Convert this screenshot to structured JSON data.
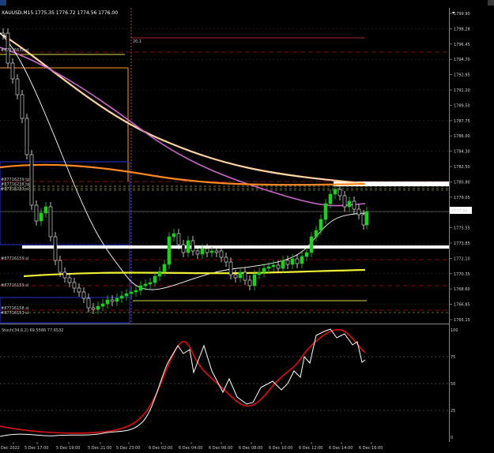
{
  "window": {
    "title": "XAUUSD,M15",
    "ohlc": "1775.35 1776.72 1774.56 1776.00",
    "colors": {
      "background": "#000000",
      "bull": "#22cc22",
      "bear": "#f0f0f0",
      "grid": "#3a3a3a"
    }
  },
  "price_axis": {
    "labels": [
      "1799.90",
      "1798.28",
      "1796.45",
      "1794.70",
      "1792.95",
      "1791.20",
      "1789.50",
      "1787.75",
      "1786.00",
      "1784.30",
      "1782.50",
      "1780.80",
      "1779.05",
      "1777.30",
      "1775.55",
      "1773.85",
      "1772.10",
      "1770.35",
      "1768.60",
      "1766.85",
      "1765.15"
    ],
    "current_price": "1777.85",
    "current_price_color": "#ffffff"
  },
  "time_axis": {
    "labels": [
      "Dec 2022",
      "5 Dec 17:00",
      "5 Dec 19:00",
      "5 Dec 21:00",
      "5 Dec 23:00",
      "6 Dec 02:00",
      "6 Dec 04:00",
      "6 Dec 06:00",
      "6 Dec 08:00",
      "6 Dec 10:00",
      "6 Dec 12:00",
      "6 Dec 14:00",
      "6 Dec 16:00"
    ]
  },
  "orders": [
    {
      "label": "#87876632 sl",
      "color": "#ffff66"
    },
    {
      "label": "#87716239 tp",
      "color": "#cccccc"
    },
    {
      "label": "#87716238 tp",
      "color": "#cccccc"
    },
    {
      "label": "#87716233 sl",
      "color": "#cccccc"
    },
    {
      "label": "#87716159 sl",
      "color": "#cccccc"
    },
    {
      "label": "#87716159 sl",
      "color": "#cccccc"
    },
    {
      "label": "#87716158 sl",
      "color": "#cccccc"
    },
    {
      "label": "#87716153 sl",
      "color": "#cccccc"
    }
  ],
  "marker": "20.1",
  "subwindow": {
    "title": "Stoch(34,6,2) 69.5586 77.6532",
    "levels": [
      "100",
      "75",
      "50",
      "25",
      "0"
    ],
    "main_color": "#ffffff",
    "signal_color": "#dd1111"
  }
}
